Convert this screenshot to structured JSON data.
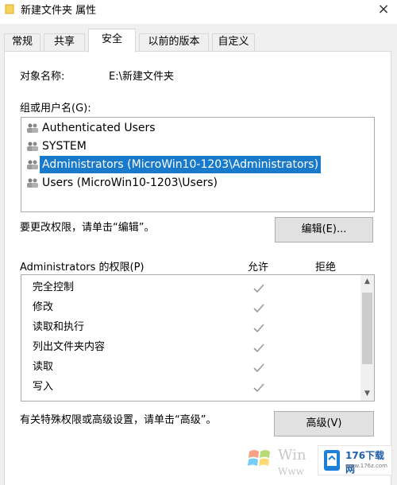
{
  "window": {
    "title": "新建文件夹 属性",
    "close_glyph": "×"
  },
  "tabs": [
    {
      "label": "常规"
    },
    {
      "label": "共享"
    },
    {
      "label": "安全"
    },
    {
      "label": "以前的版本"
    },
    {
      "label": "自定义"
    }
  ],
  "active_tab": "安全",
  "object": {
    "label": "对象名称:",
    "value": "E:\\新建文件夹"
  },
  "groups": {
    "label": "组或用户名(G):",
    "items": [
      {
        "name": "Authenticated Users",
        "selected": false
      },
      {
        "name": "SYSTEM",
        "selected": false
      },
      {
        "name": "Administrators (MicroWin10-1203\\Administrators)",
        "selected": true
      },
      {
        "name": "Users (MicroWin10-1203\\Users)",
        "selected": false
      }
    ],
    "icon": "users-icon"
  },
  "edit": {
    "hint": "要更改权限，请单击“编辑”。",
    "button_label": "编辑(E)..."
  },
  "permissions": {
    "title": "Administrators 的权限(P)",
    "allow_header": "允许",
    "deny_header": "拒绝",
    "rows": [
      {
        "name": "完全控制",
        "allow": true,
        "deny": false
      },
      {
        "name": "修改",
        "allow": true,
        "deny": false
      },
      {
        "name": "读取和执行",
        "allow": true,
        "deny": false
      },
      {
        "name": "列出文件夹内容",
        "allow": true,
        "deny": false
      },
      {
        "name": "读取",
        "allow": true,
        "deny": false
      },
      {
        "name": "写入",
        "allow": true,
        "deny": false
      }
    ],
    "check_glyph": "✓",
    "scroll_up_glyph": "▲",
    "scroll_down_glyph": "▼"
  },
  "advanced": {
    "hint": "有关特殊权限或高级设置，请单击“高级”。",
    "button_label": "高级(V)"
  },
  "watermark": {
    "left_text_1": "Win",
    "left_text_2": "Www",
    "logo_text": "176下载网",
    "logo_sub": "www.176z.com"
  },
  "colors": {
    "selection": "#1979ca",
    "check_gray": "#9a9a9a"
  }
}
